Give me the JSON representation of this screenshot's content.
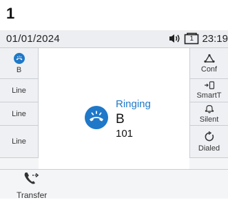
{
  "step_number": "1",
  "status": {
    "date": "01/01/2024",
    "time": "23:19",
    "line_indicator": "1"
  },
  "left_keys": [
    {
      "label": "B",
      "icon": "ringing-handset-icon"
    },
    {
      "label": "Line"
    },
    {
      "label": "Line"
    },
    {
      "label": "Line"
    }
  ],
  "right_keys": [
    {
      "label": "Conf",
      "icon": "conference-icon"
    },
    {
      "label": "SmartT",
      "icon": "smart-transfer-icon"
    },
    {
      "label": "Silent",
      "icon": "bell-icon"
    },
    {
      "label": "Dialed",
      "icon": "redial-icon"
    }
  ],
  "call": {
    "state": "Ringing",
    "name": "B",
    "number": "101"
  },
  "bottom": {
    "transfer_label": "Transfer"
  },
  "colors": {
    "accent": "#1f78c8",
    "background": "#f4f5f7"
  }
}
